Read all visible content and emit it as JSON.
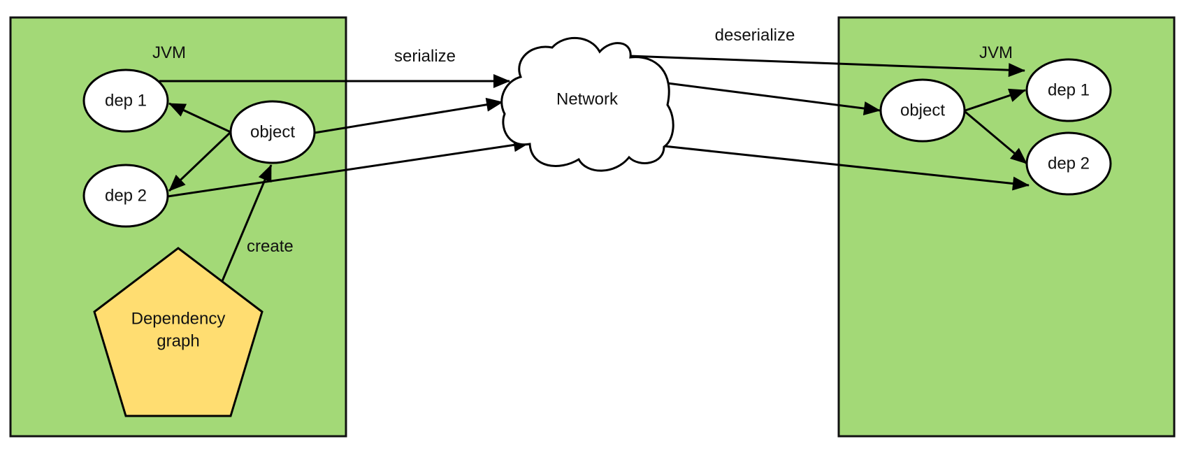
{
  "colors": {
    "jvm_fill": "#a3d977",
    "graph_fill": "#ffdd71",
    "node_fill": "#ffffff",
    "stroke": "#000000"
  },
  "left_jvm": {
    "label": "JVM",
    "nodes": {
      "dep1": "dep 1",
      "object": "object",
      "dep2": "dep 2"
    },
    "graph": {
      "line1": "Dependency",
      "line2": "graph"
    },
    "create_label": "create"
  },
  "network": {
    "label": "Network"
  },
  "edge_labels": {
    "serialize": "serialize",
    "deserialize": "deserialize"
  },
  "right_jvm": {
    "label": "JVM",
    "nodes": {
      "object": "object",
      "dep1": "dep 1",
      "dep2": "dep 2"
    }
  }
}
